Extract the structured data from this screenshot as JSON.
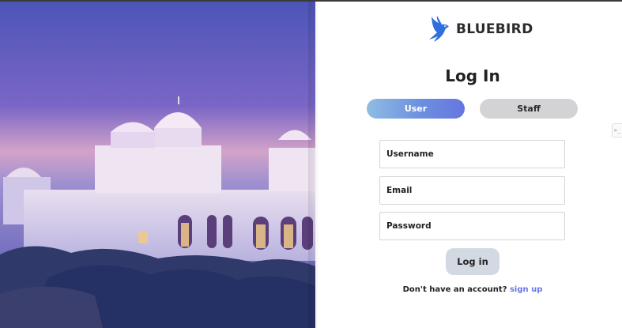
{
  "brand": {
    "name": "BLUEBIRD",
    "icon": "bluebird-logo-icon",
    "color": "#2f6fe0"
  },
  "page": {
    "title": "Log In"
  },
  "tabs": [
    {
      "label": "User",
      "active": true
    },
    {
      "label": "Staff",
      "active": false
    }
  ],
  "form": {
    "username_placeholder": "Username",
    "email_placeholder": "Email",
    "password_placeholder": "Password",
    "submit_label": "Log in"
  },
  "footer": {
    "prompt": "Don't have an account?",
    "link_label": "sign up"
  },
  "side_tab": {
    "label": ">_"
  },
  "colors": {
    "accent": "#6676e0",
    "link": "#6a76e6",
    "tab_inactive": "#d3d3d6",
    "button": "#d3d9e3"
  }
}
